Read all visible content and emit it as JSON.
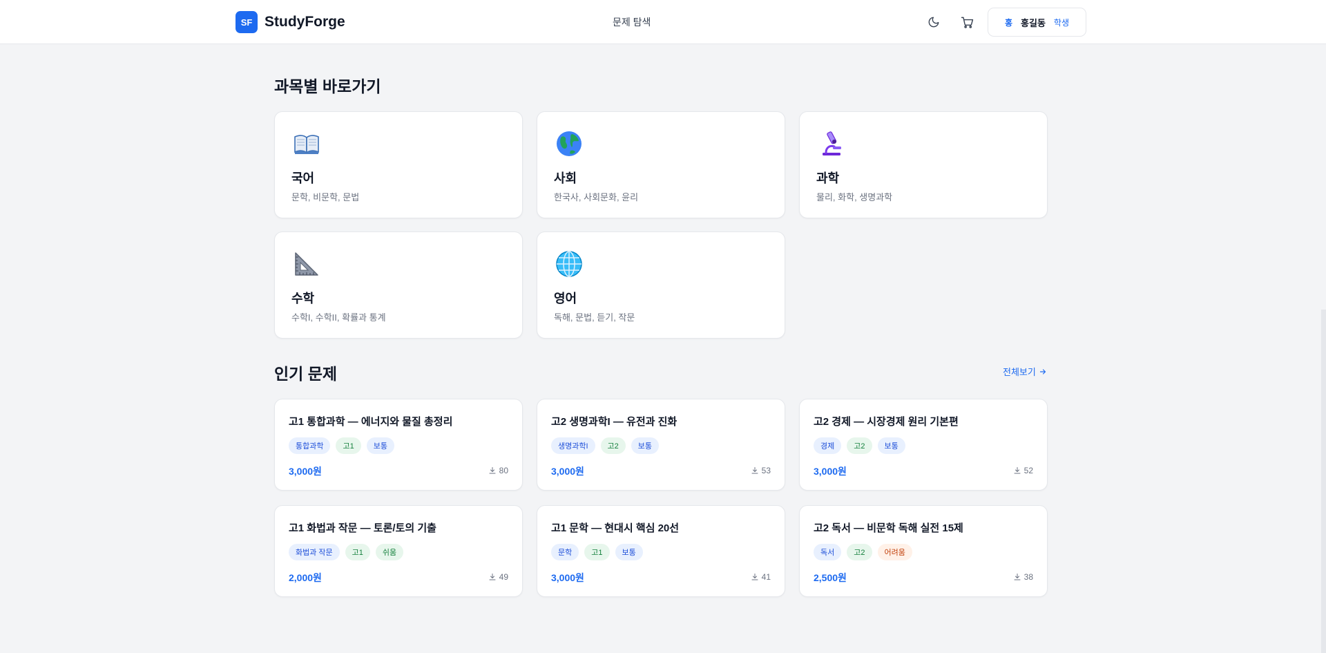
{
  "header": {
    "logo_mark": "SF",
    "brand_name": "StudyForge",
    "nav_browse": "문제 탐색",
    "user_initial": "홍",
    "user_name": "홍길동",
    "user_role": "학생"
  },
  "subjects_section": {
    "title": "과목별 바로가기",
    "items": [
      {
        "name": "국어",
        "desc": "문학, 비문학, 문법",
        "icon": "book-icon"
      },
      {
        "name": "사회",
        "desc": "한국사, 사회문화, 윤리",
        "icon": "globe-earth-icon"
      },
      {
        "name": "과학",
        "desc": "물리, 화학, 생명과학",
        "icon": "microscope-icon"
      },
      {
        "name": "수학",
        "desc": "수학I, 수학II, 확률과 통계",
        "icon": "triangle-ruler-icon"
      },
      {
        "name": "영어",
        "desc": "독해, 문법, 듣기, 작문",
        "icon": "globe-meridians-icon"
      }
    ]
  },
  "popular_section": {
    "title": "인기 문제",
    "view_all": "전체보기",
    "items": [
      {
        "title": "고1 통합과학 — 에너지와 물질 총정리",
        "subject": "통합과학",
        "grade": "고1",
        "difficulty": "보통",
        "price": "3,000원",
        "downloads": "80"
      },
      {
        "title": "고2 생명과학I — 유전과 진화",
        "subject": "생명과학I",
        "grade": "고2",
        "difficulty": "보통",
        "price": "3,000원",
        "downloads": "53"
      },
      {
        "title": "고2 경제 — 시장경제 원리 기본편",
        "subject": "경제",
        "grade": "고2",
        "difficulty": "보통",
        "price": "3,000원",
        "downloads": "52"
      },
      {
        "title": "고1 화법과 작문 — 토론/토의 기출",
        "subject": "화법과 작문",
        "grade": "고1",
        "difficulty": "쉬움",
        "price": "2,000원",
        "downloads": "49"
      },
      {
        "title": "고1 문학 — 현대시 핵심 20선",
        "subject": "문학",
        "grade": "고1",
        "difficulty": "보통",
        "price": "3,000원",
        "downloads": "41"
      },
      {
        "title": "고2 독서 — 비문학 독해 실전 15제",
        "subject": "독서",
        "grade": "고2",
        "difficulty": "어려움",
        "price": "2,500원",
        "downloads": "38"
      }
    ]
  },
  "colors": {
    "accent": "#1d6af0",
    "background": "#f3f4f6",
    "tag_green": "#15803d",
    "tag_orange": "#c2410c"
  }
}
